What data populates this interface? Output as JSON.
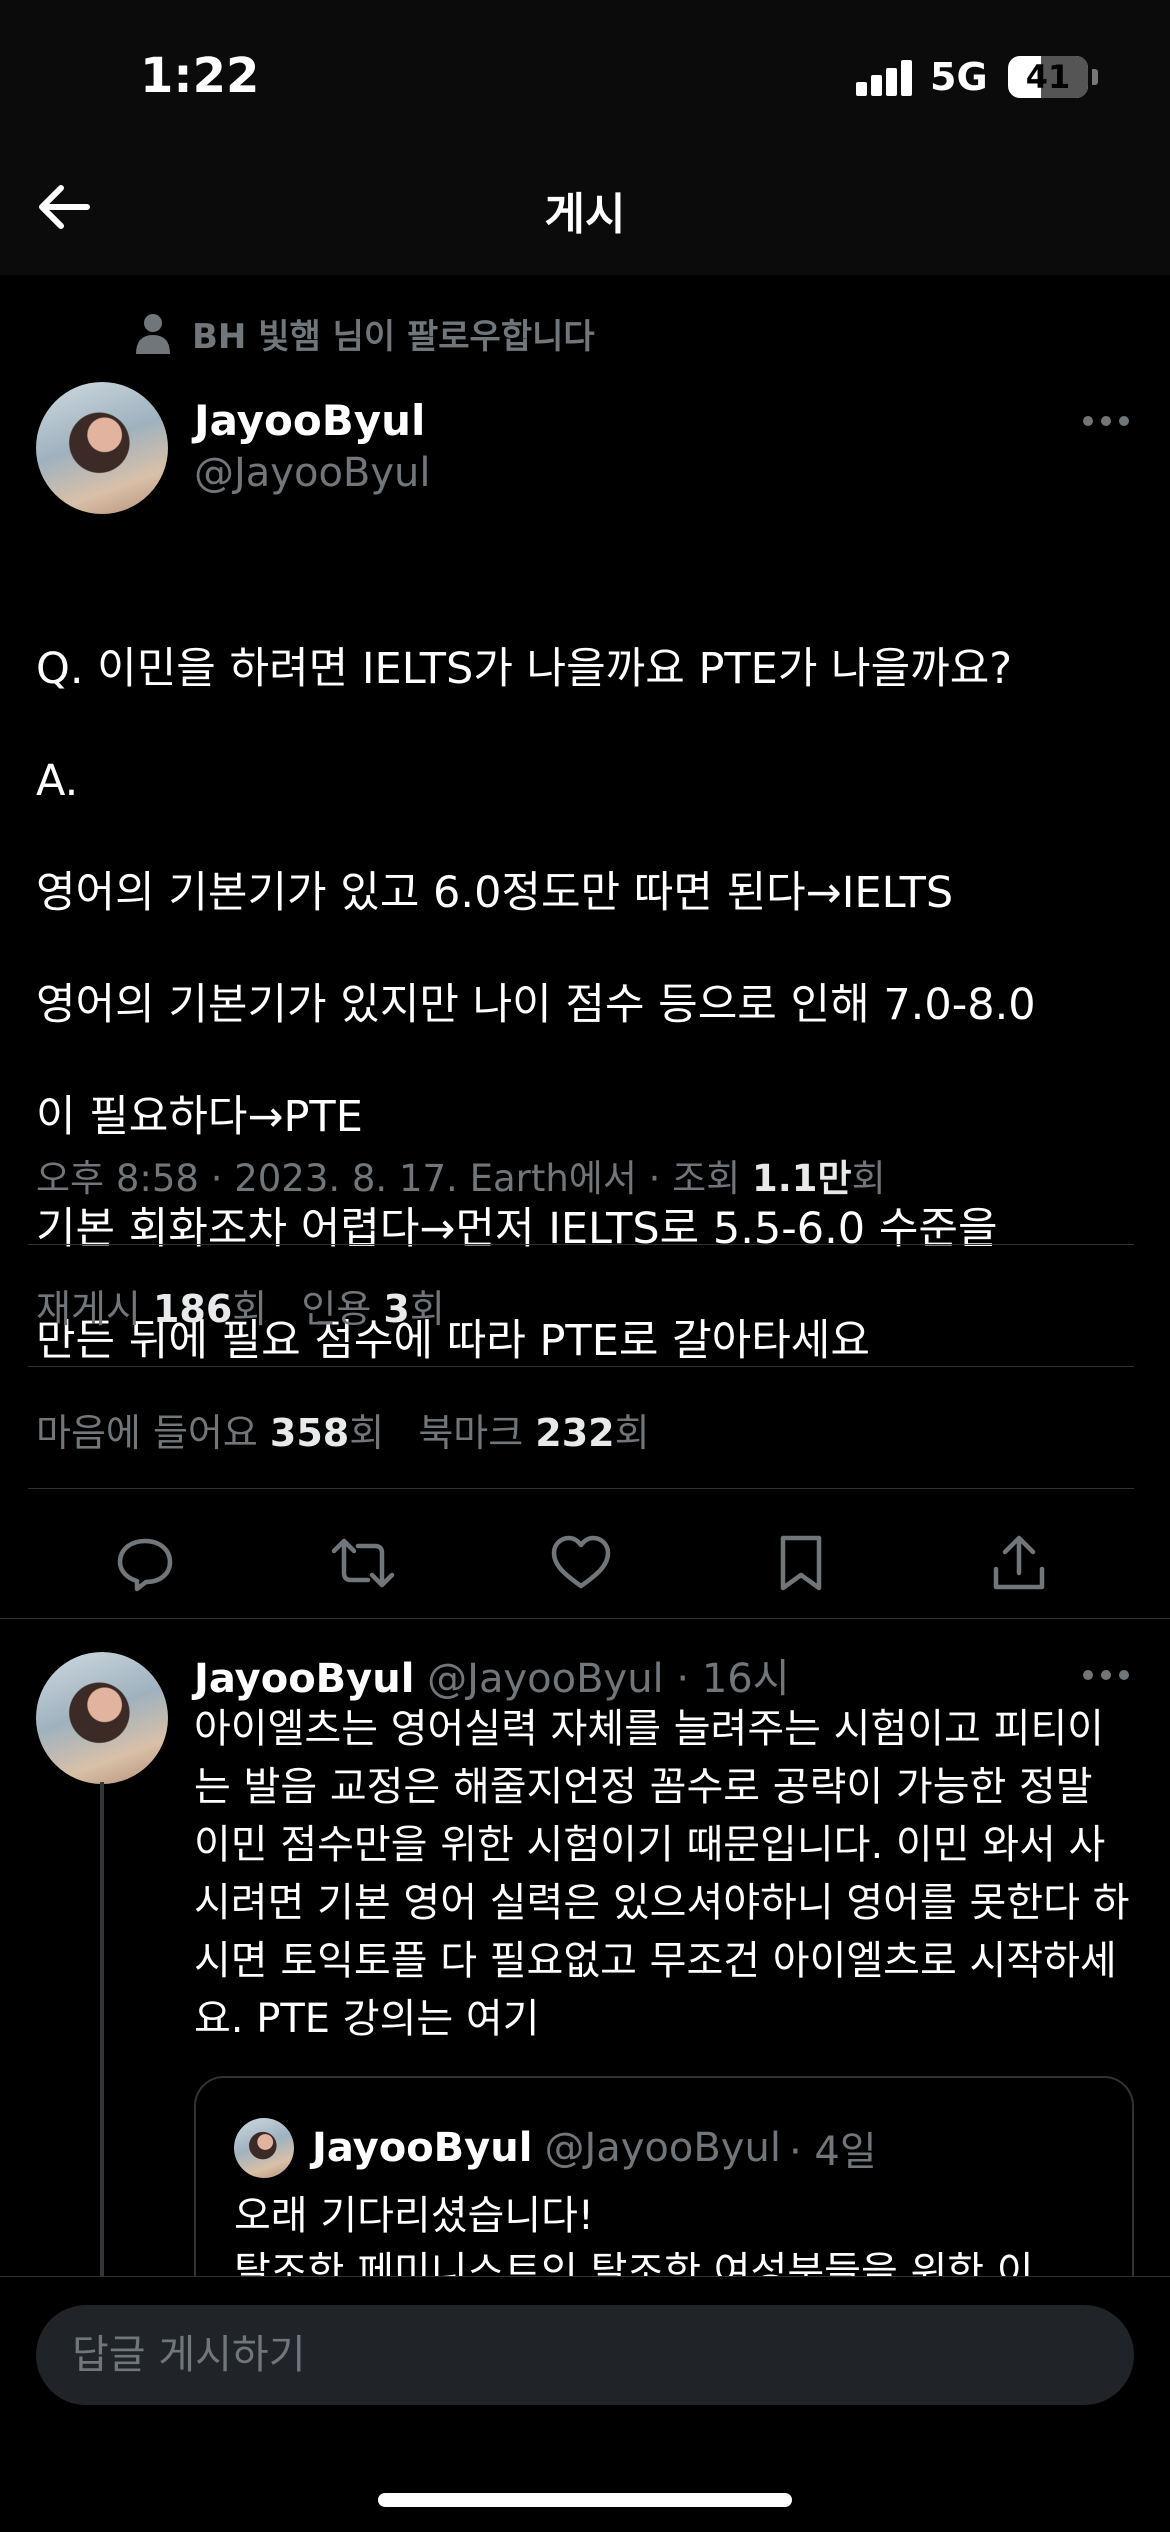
{
  "status_bar": {
    "time": "1:22",
    "network": "5G",
    "battery": "41",
    "battery_level_percent": 41
  },
  "header": {
    "title": "게시",
    "back_icon": "arrow-left-icon"
  },
  "social_context": {
    "text": "BH 빛햄 님이 팔로우합니다",
    "icon": "person-icon"
  },
  "tweet": {
    "author_name": "JayooByul",
    "author_handle": "@JayooByul",
    "lines": [
      "Q. 이민을 하려면 IELTS가 나을까요 PTE가 나을까요?",
      "A.",
      "영어의 기본기가 있고 6.0정도만 따면 된다→IELTS",
      "영어의 기본기가 있지만 나이 점수 등으로 인해 7.0-8.0",
      "이 필요하다→PTE",
      "기본 회화조차 어렵다→먼저 IELTS로 5.5-6.0 수준을",
      "만든 뒤에 필요 점수에 따라 PTE로 갈아타세요"
    ],
    "meta_prefix": "오후 8:58 · 2023. 8. 17. Earth에서 · 조회 ",
    "views": "1.1만",
    "views_suffix": "회",
    "reposts_label": "재게시 ",
    "reposts": "186",
    "quotes_label": "인용 ",
    "quotes": "3",
    "likes_label": "마음에 들어요 ",
    "likes": "358",
    "bookmarks_label": "북마크 ",
    "bookmarks": "232",
    "count_suffix": "회"
  },
  "actions": [
    "reply-icon",
    "retweet-icon",
    "like-icon",
    "bookmark-icon",
    "share-icon"
  ],
  "reply": {
    "author_name": "JayooByul",
    "author_handle": "@JayooByul",
    "time": "· 16시",
    "text": "아이엘츠는 영어실력 자체를 늘려주는 시험이고 피티이는 발음 교정은 해줄지언정 꼼수로 공략이 가능한 정말 이민 점수만을 위한 시험이기 때문입니다. 이민 와서 사시려면 기본 영어 실력은 있으셔야하니 영어를 못한다 하시면 토익토플 다 필요없고 무조건 아이엘츠로 시작하세요. PTE 강의는 여기"
  },
  "quote": {
    "author_name": "JayooByul",
    "author_handle": "@JayooByul",
    "time": "· 4일",
    "text": "오래 기다리셨습니다!\n탈조한 페미니스트인 탈조한 여성분들을 위한 이"
  },
  "composer": {
    "placeholder": "답글 게시하기"
  },
  "colors": {
    "background": "#000000",
    "text": "#e7e9ea",
    "secondary": "#71767b",
    "divider": "#2f3336"
  }
}
